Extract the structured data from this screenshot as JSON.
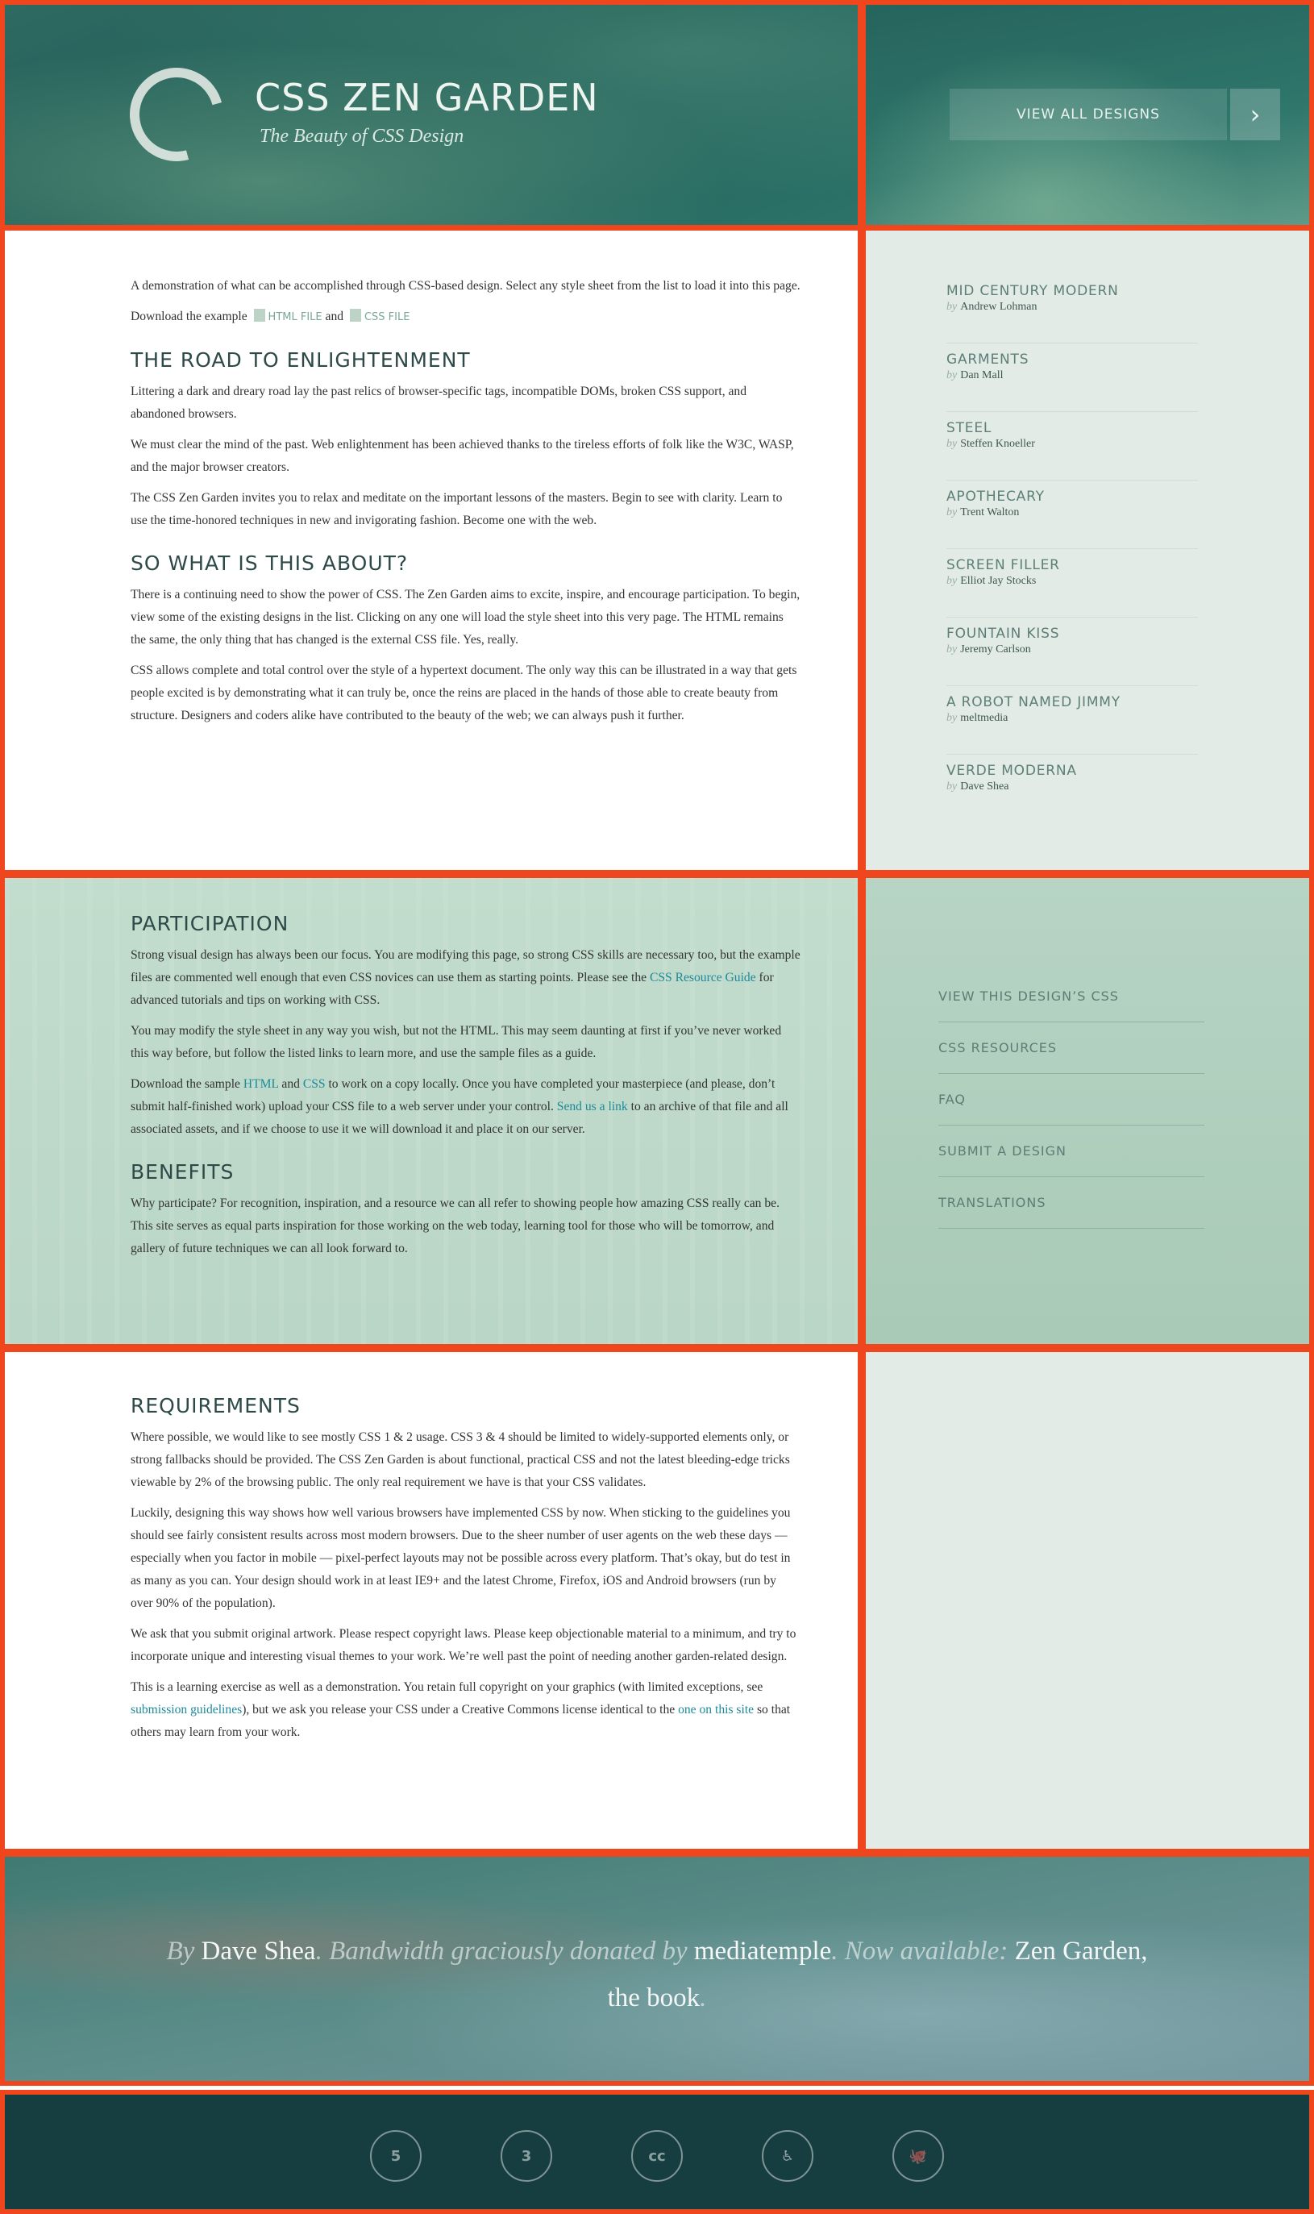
{
  "header": {
    "title": "CSS Zen Garden",
    "tagline": "The Beauty of CSS Design",
    "view_all_label": "View All Designs",
    "view_all_arrow": "›"
  },
  "intro": {
    "summary": "A demonstration of what can be accomplished through CSS-based design. Select any style sheet from the list to load it into this page.",
    "download_prefix": "Download the example",
    "html_file": "HTML File",
    "and": "and",
    "css_file": "CSS File"
  },
  "road": {
    "heading": "The Road to Enlightenment",
    "p1": "Littering a dark and dreary road lay the past relics of browser-specific tags, incompatible DOMs, broken CSS support, and abandoned browsers.",
    "p2": "We must clear the mind of the past. Web enlightenment has been achieved thanks to the tireless efforts of folk like the W3C, WASP, and the major browser creators.",
    "p3": "The CSS Zen Garden invites you to relax and meditate on the important lessons of the masters. Begin to see with clarity. Learn to use the time-honored techniques in new and invigorating fashion. Become one with the web."
  },
  "about": {
    "heading": "So What is This About?",
    "p1": "There is a continuing need to show the power of CSS. The Zen Garden aims to excite, inspire, and encourage participation. To begin, view some of the existing designs in the list. Clicking on any one will load the style sheet into this very page. The HTML remains the same, the only thing that has changed is the external CSS file. Yes, really.",
    "p2": "CSS allows complete and total control over the style of a hypertext document. The only way this can be illustrated in a way that gets people excited is by demonstrating what it can truly be, once the reins are placed in the hands of those able to create beauty from structure. Designers and coders alike have contributed to the beauty of the web; we can always push it further."
  },
  "designs": [
    {
      "name": "Mid Century Modern",
      "by": "by",
      "author": "Andrew Lohman"
    },
    {
      "name": "Garments",
      "by": "by",
      "author": "Dan Mall"
    },
    {
      "name": "Steel",
      "by": "by",
      "author": "Steffen Knoeller"
    },
    {
      "name": "Apothecary",
      "by": "by",
      "author": "Trent Walton"
    },
    {
      "name": "Screen Filler",
      "by": "by",
      "author": "Elliot Jay Stocks"
    },
    {
      "name": "Fountain Kiss",
      "by": "by",
      "author": "Jeremy Carlson"
    },
    {
      "name": "A Robot Named Jimmy",
      "by": "by",
      "author": "meltmedia"
    },
    {
      "name": "Verde Moderna",
      "by": "by",
      "author": "Dave Shea"
    }
  ],
  "participation": {
    "heading": "Participation",
    "p1_a": "Strong visual design has always been our focus. You are modifying this page, so strong CSS skills are necessary too, but the example files are commented well enough that even CSS novices can use them as starting points. Please see the ",
    "p1_link": "CSS Resource Guide",
    "p1_b": " for advanced tutorials and tips on working with CSS.",
    "p2": "You may modify the style sheet in any way you wish, but not the HTML. This may seem daunting at first if you’ve never worked this way before, but follow the listed links to learn more, and use the sample files as a guide.",
    "p3_a": "Download the sample ",
    "p3_html": "HTML",
    "p3_and": " and ",
    "p3_css": "CSS",
    "p3_b": " to work on a copy locally. Once you have completed your masterpiece (and please, don’t submit half-finished work) upload your CSS file to a web server under your control. ",
    "p3_link": "Send us a link",
    "p3_c": " to an archive of that file and all associated assets, and if we choose to use it we will download it and place it on our server."
  },
  "benefits": {
    "heading": "Benefits",
    "p1": "Why participate? For recognition, inspiration, and a resource we can all refer to showing people how amazing CSS really can be. This site serves as equal parts inspiration for those working on the web today, learning tool for those who will be tomorrow, and gallery of future techniques we can all look forward to."
  },
  "resources": [
    {
      "label": "View This Design’s CSS"
    },
    {
      "label": "CSS Resources"
    },
    {
      "label": "FAQ"
    },
    {
      "label": "Submit a Design"
    },
    {
      "label": "Translations"
    }
  ],
  "requirements": {
    "heading": "Requirements",
    "p1": "Where possible, we would like to see mostly CSS 1 & 2 usage. CSS 3 & 4 should be limited to widely-supported elements only, or strong fallbacks should be provided. The CSS Zen Garden is about functional, practical CSS and not the latest bleeding-edge tricks viewable by 2% of the browsing public. The only real requirement we have is that your CSS validates.",
    "p2": "Luckily, designing this way shows how well various browsers have implemented CSS by now. When sticking to the guidelines you should see fairly consistent results across most modern browsers. Due to the sheer number of user agents on the web these days — especially when you factor in mobile — pixel-perfect layouts may not be possible across every platform. That’s okay, but do test in as many as you can. Your design should work in at least IE9+ and the latest Chrome, Firefox, iOS and Android browsers (run by over 90% of the population).",
    "p3": "We ask that you submit original artwork. Please respect copyright laws. Please keep objectionable material to a minimum, and try to incorporate unique and interesting visual themes to your work. We’re well past the point of needing another garden-related design.",
    "p4_a": "This is a learning exercise as well as a demonstration. You retain full copyright on your graphics (with limited exceptions, see ",
    "p4_link1": "submission guidelines",
    "p4_b": "), but we ask you release your CSS under a Creative Commons license identical to the ",
    "p4_link2": "one on this site",
    "p4_c": " so that others may learn from your work."
  },
  "footer": {
    "by": "By",
    "author": "Dave Shea",
    "bandwidth": ". Bandwidth graciously donated by",
    "sponsor": "mediatemple",
    "available": ". Now available:",
    "book": "Zen Garden, the book",
    "end": "."
  },
  "bottom_icons": [
    {
      "name": "html5-icon",
      "glyph": "5"
    },
    {
      "name": "css3-icon",
      "glyph": "3"
    },
    {
      "name": "creative-commons-icon",
      "glyph": "cc"
    },
    {
      "name": "accessibility-icon",
      "glyph": "♿"
    },
    {
      "name": "github-icon",
      "glyph": "🐙"
    }
  ]
}
